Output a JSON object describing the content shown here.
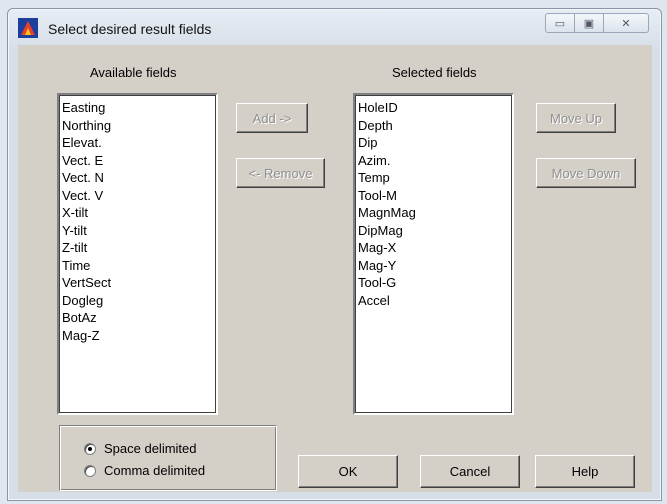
{
  "window": {
    "title": "Select desired result fields",
    "minimize_glyph": "▭",
    "maximize_glyph": "▣",
    "close_glyph": "✕"
  },
  "available": {
    "label": "Available fields",
    "items": [
      "Easting",
      "Northing",
      "Elevat.",
      "Vect. E",
      "Vect. N",
      "Vect. V",
      "X-tilt",
      "Y-tilt",
      "Z-tilt",
      "Time",
      "VertSect",
      "Dogleg",
      "BotAz",
      "Mag-Z"
    ]
  },
  "selected": {
    "label": "Selected fields",
    "items": [
      "HoleID",
      "Depth",
      "Dip",
      "Azim.",
      "Temp",
      "Tool-M",
      "MagnMag",
      "DipMag",
      "Mag-X",
      "Mag-Y",
      "Tool-G",
      "Accel"
    ]
  },
  "buttons": {
    "add": "Add ->",
    "remove": "<- Remove",
    "move_up": "Move Up",
    "move_down": "Move Down",
    "ok": "OK",
    "cancel": "Cancel",
    "help": "Help"
  },
  "delimiter": {
    "options": [
      "Space delimited",
      "Comma delimited"
    ],
    "selected": "Space delimited"
  },
  "colors": {
    "client_bg": "#d4d0c8",
    "disabled_text": "#8f8f8f"
  }
}
